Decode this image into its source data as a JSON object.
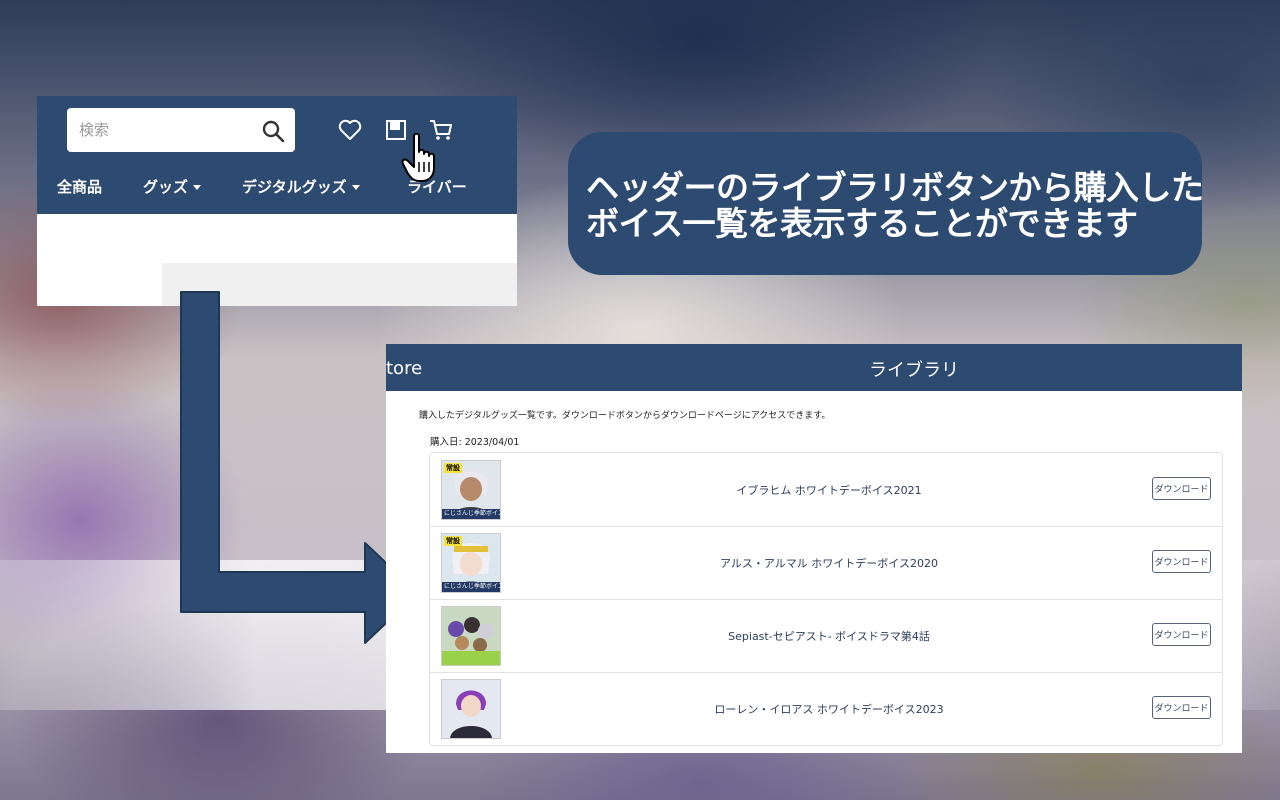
{
  "header": {
    "search_placeholder": "検索",
    "icons": [
      "search-icon",
      "heart-icon",
      "library-icon",
      "cart-icon"
    ],
    "nav": [
      {
        "label": "全商品",
        "dropdown": false
      },
      {
        "label": "グッズ",
        "dropdown": true
      },
      {
        "label": "デジタルグッズ",
        "dropdown": true
      },
      {
        "label": "ライバー",
        "dropdown": false
      }
    ]
  },
  "callout": {
    "line1": "ヘッダーのライブラリボタンから購入した",
    "line2": "ボイス一覧を表示することができます"
  },
  "library": {
    "brand": "tore",
    "title": "ライブラリ",
    "description": "購入したデジタルグッズ一覧です。ダウンロードボタンからダウンロードページにアクセスできます。",
    "purchase_date": "購入日: 2023/04/01",
    "items": [
      {
        "title": "イブラヒム ホワイトデーボイス2021",
        "badge": "常設",
        "strip": "にじさんじ季節ボイス",
        "button": "ダウンロード"
      },
      {
        "title": "アルス・アルマル ホワイトデーボイス2020",
        "badge": "常設",
        "strip": "にじさんじ季節ボイス",
        "button": "ダウンロード"
      },
      {
        "title": "Sepiast-セピアスト- ボイスドラマ第4話",
        "badge": "",
        "strip": "",
        "button": "ダウンロード"
      },
      {
        "title": "ローレン・イロアス ホワイトデーボイス2023",
        "badge": "",
        "strip": "",
        "button": "ダウンロード"
      }
    ]
  },
  "colors": {
    "brand_navy": "#2d4a70",
    "badge_yellow": "#f7e43a",
    "text_dark": "#2c3e5c"
  }
}
